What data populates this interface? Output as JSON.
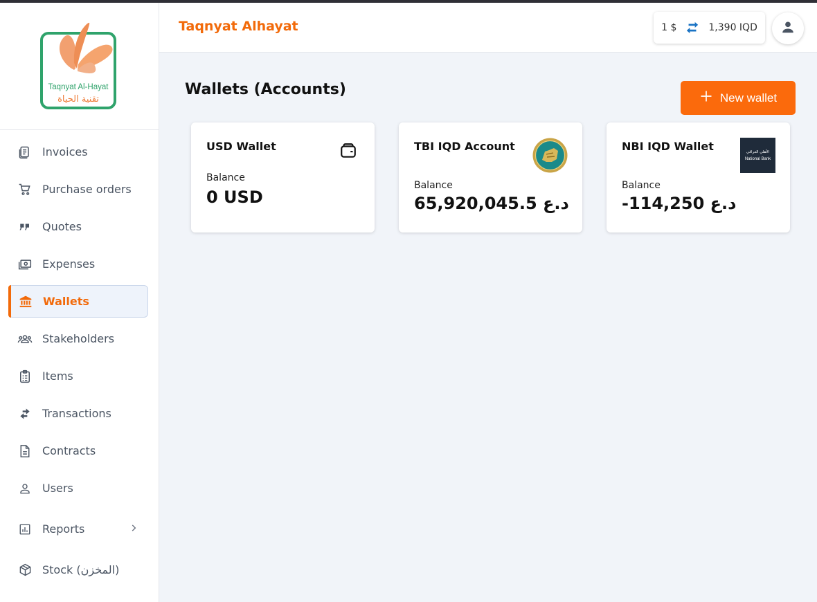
{
  "app": {
    "brand": "Taqnyat Alhayat",
    "logo_text_en": "Taqnyat Al-Hayat",
    "logo_text_ar": "تقنية الحياة",
    "accent_color": "#f26a0a"
  },
  "header": {
    "rate_usd": "1 $",
    "rate_iqd": "1,390 IQD",
    "swap_icon": "swap-horizontal-icon",
    "avatar_icon": "person-icon"
  },
  "sidebar": {
    "items": [
      {
        "label": "Invoices",
        "icon": "invoice-icon"
      },
      {
        "label": "Purchase orders",
        "icon": "cart-icon"
      },
      {
        "label": "Quotes",
        "icon": "quote-icon"
      },
      {
        "label": "Expenses",
        "icon": "cash-icon"
      },
      {
        "label": "Wallets",
        "icon": "bank-icon",
        "active": true
      },
      {
        "label": "Stakeholders",
        "icon": "people-icon"
      },
      {
        "label": "Items",
        "icon": "clipboard-icon"
      },
      {
        "label": "Transactions",
        "icon": "transfer-icon"
      },
      {
        "label": "Contracts",
        "icon": "document-icon"
      },
      {
        "label": "Users",
        "icon": "user-icon"
      },
      {
        "label": "Reports",
        "icon": "chart-icon",
        "has_submenu": true
      },
      {
        "label": "Stock (المخزن)",
        "icon": "box-icon"
      }
    ]
  },
  "main": {
    "title": "Wallets (Accounts)",
    "new_button_label": "New wallet",
    "wallets": [
      {
        "name": "USD Wallet",
        "balance_label": "Balance",
        "balance": "0 USD",
        "emblem": "wallet-icon"
      },
      {
        "name": "TBI IQD Account",
        "balance_label": "Balance",
        "balance": "65,920,045.5 د.ع",
        "emblem": "tbi-logo"
      },
      {
        "name": "NBI IQD Wallet",
        "balance_label": "Balance",
        "balance": "-114,250 د.ع",
        "emblem": "nbi-logo",
        "emblem_text_ar": "الأهلي العراقي",
        "emblem_text_en": "National Bank"
      }
    ]
  }
}
